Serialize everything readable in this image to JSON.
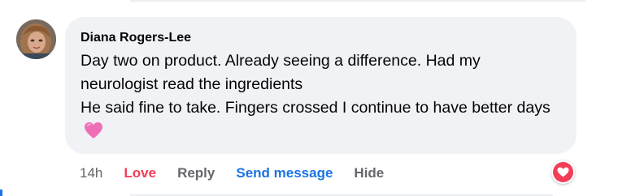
{
  "comment": {
    "author": "Diana Rogers-Lee",
    "lines": [
      "Day two on product. Already seeing a difference. Had my neurologist read the ingredients",
      "He said fine to take. Fingers crossed I continue to have better days"
    ],
    "emoji": "pink-heart-icon",
    "timestamp": "14h",
    "actions": {
      "love": "Love",
      "reply": "Reply",
      "send_message": "Send message",
      "hide": "Hide"
    },
    "reaction": "love-reaction-icon"
  },
  "colors": {
    "bubble_bg": "#f0f2f5",
    "love": "#f33e58",
    "link": "#1b74e4",
    "muted": "#65676b",
    "text": "#050505"
  }
}
